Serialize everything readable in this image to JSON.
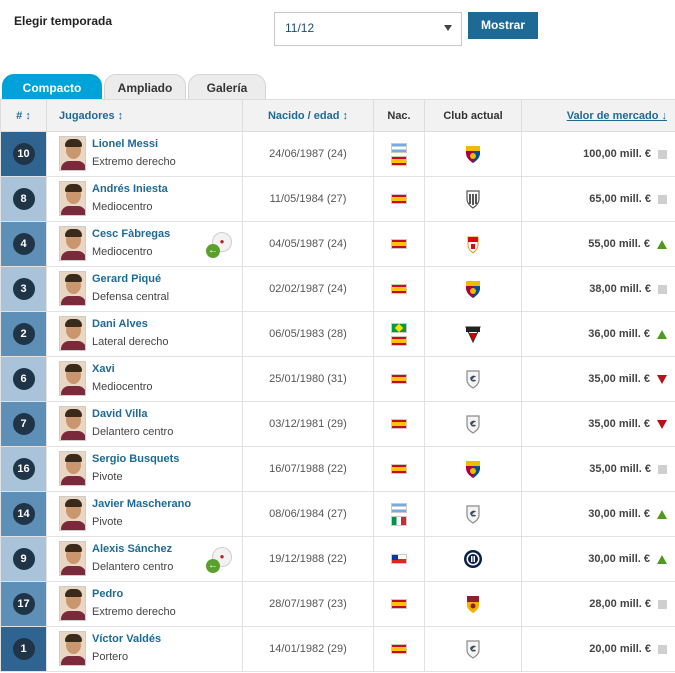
{
  "season": {
    "label": "Elegir temporada",
    "selected": "11/12",
    "button": "Mostrar"
  },
  "tabs": [
    {
      "label": "Compacto",
      "active": true
    },
    {
      "label": "Ampliado",
      "active": false
    },
    {
      "label": "Galería",
      "active": false
    }
  ],
  "headers": {
    "number": "# ↕",
    "players": "Jugadores ↕",
    "born": "Nacido / edad ↕",
    "nat": "Nac.",
    "club": "Club actual",
    "value": "Valor de mercado ↓"
  },
  "colors": {
    "accent": "#00a3d9",
    "link": "#1d6a96",
    "up": "#4f9a1e",
    "down": "#b8111c"
  },
  "players": [
    {
      "number": "10",
      "name": "Lionel Messi",
      "position": "Extremo derecho",
      "born": "24/06/1987 (24)",
      "nationalities": [
        "ar",
        "es"
      ],
      "club_icon": "barcelona-crest-icon",
      "value": "100,00 mill. €",
      "trend": "flat",
      "loan": false
    },
    {
      "number": "8",
      "name": "Andrés Iniesta",
      "position": "Mediocentro",
      "born": "11/05/1984 (27)",
      "nationalities": [
        "es"
      ],
      "club_icon": "vissel-kobe-crest-icon",
      "value": "65,00 mill. €",
      "trend": "flat",
      "loan": false
    },
    {
      "number": "4",
      "name": "Cesc Fàbregas",
      "position": "Mediocentro",
      "born": "04/05/1987 (24)",
      "nationalities": [
        "es"
      ],
      "club_icon": "monaco-crest-icon",
      "value": "55,00 mill. €",
      "trend": "up",
      "loan": true
    },
    {
      "number": "3",
      "name": "Gerard Piqué",
      "position": "Defensa central",
      "born": "02/02/1987 (24)",
      "nationalities": [
        "es"
      ],
      "club_icon": "barcelona-crest-icon",
      "value": "38,00 mill. €",
      "trend": "flat",
      "loan": false
    },
    {
      "number": "2",
      "name": "Dani Alves",
      "position": "Lateral derecho",
      "born": "06/05/1983 (28)",
      "nationalities": [
        "br",
        "es"
      ],
      "club_icon": "sao-paulo-crest-icon",
      "value": "36,00 mill. €",
      "trend": "up",
      "loan": false
    },
    {
      "number": "6",
      "name": "Xavi",
      "position": "Mediocentro",
      "born": "25/01/1980 (31)",
      "nationalities": [
        "es"
      ],
      "club_icon": "retired-icon",
      "value": "35,00 mill. €",
      "trend": "down",
      "loan": false
    },
    {
      "number": "7",
      "name": "David Villa",
      "position": "Delantero centro",
      "born": "03/12/1981 (29)",
      "nationalities": [
        "es"
      ],
      "club_icon": "retired-icon",
      "value": "35,00 mill. €",
      "trend": "down",
      "loan": false
    },
    {
      "number": "16",
      "name": "Sergio Busquets",
      "position": "Pivote",
      "born": "16/07/1988 (22)",
      "nationalities": [
        "es"
      ],
      "club_icon": "barcelona-crest-icon",
      "value": "35,00 mill. €",
      "trend": "flat",
      "loan": false
    },
    {
      "number": "14",
      "name": "Javier Mascherano",
      "position": "Pivote",
      "born": "08/06/1984 (27)",
      "nationalities": [
        "ar",
        "it"
      ],
      "club_icon": "retired-icon",
      "value": "30,00 mill. €",
      "trend": "up",
      "loan": false
    },
    {
      "number": "9",
      "name": "Alexis Sánchez",
      "position": "Delantero centro",
      "born": "19/12/1988 (22)",
      "nationalities": [
        "cl"
      ],
      "club_icon": "inter-crest-icon",
      "value": "30,00 mill. €",
      "trend": "up",
      "loan": true
    },
    {
      "number": "17",
      "name": "Pedro",
      "position": "Extremo derecho",
      "born": "28/07/1987 (23)",
      "nationalities": [
        "es"
      ],
      "club_icon": "roma-crest-icon",
      "value": "28,00 mill. €",
      "trend": "flat",
      "loan": false
    },
    {
      "number": "1",
      "name": "Víctor Valdés",
      "position": "Portero",
      "born": "14/01/1982 (29)",
      "nationalities": [
        "es"
      ],
      "club_icon": "retired-icon",
      "value": "20,00 mill. €",
      "trend": "flat",
      "loan": false
    }
  ]
}
